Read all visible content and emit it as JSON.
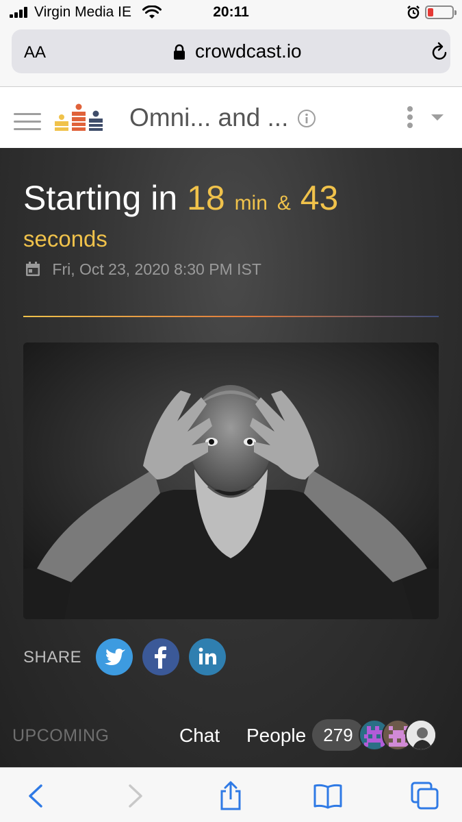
{
  "status_bar": {
    "carrier": "Virgin Media IE",
    "time": "20:11"
  },
  "browser": {
    "text_size_label": "AA",
    "domain": "crowdcast.io"
  },
  "header": {
    "event_title": "Omni... and ..."
  },
  "countdown": {
    "prefix": "Starting in",
    "minutes_value": "18",
    "minutes_unit": "min",
    "separator": "&",
    "seconds_value": "43",
    "seconds_unit": "seconds"
  },
  "event": {
    "datetime": "Fri, Oct 23, 2020 8:30 PM IST"
  },
  "share": {
    "label": "SHARE",
    "networks": [
      "twitter",
      "facebook",
      "linkedin"
    ]
  },
  "tabs": {
    "status": "UPCOMING",
    "chat": "Chat",
    "people": "People",
    "people_count": "279"
  },
  "colors": {
    "accent_gold": "#f0c24b",
    "twitter": "#3d9be0",
    "facebook": "#3b5998",
    "linkedin": "#2f7fb0",
    "background_dark": "#333333"
  }
}
